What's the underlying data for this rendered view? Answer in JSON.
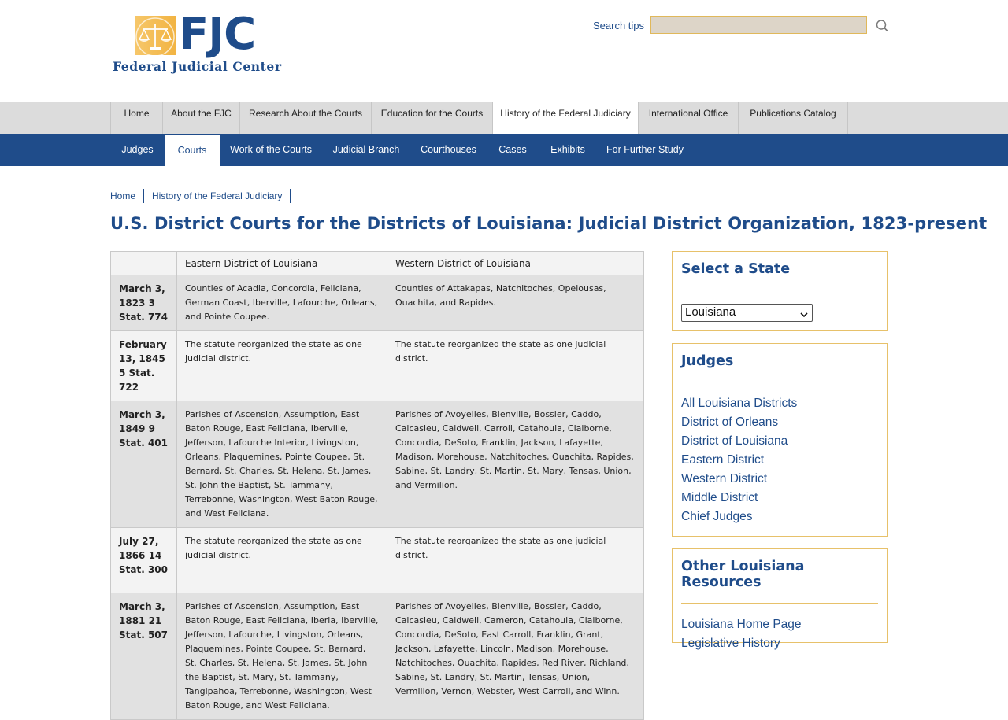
{
  "header": {
    "logo_letters": "FJC",
    "logo_sub": "Federal Judicial Center",
    "search_tips": "Search tips",
    "search_placeholder": ""
  },
  "topnav": [
    {
      "label": "Home"
    },
    {
      "label": "About the FJC"
    },
    {
      "label": "Research About the Courts"
    },
    {
      "label": "Education for the Courts"
    },
    {
      "label": "History of the Federal Judiciary",
      "active": true
    },
    {
      "label": "International Office"
    },
    {
      "label": "Publications Catalog"
    }
  ],
  "subnav": [
    {
      "label": "Judges"
    },
    {
      "label": "Courts",
      "active": true
    },
    {
      "label": "Work of the Courts"
    },
    {
      "label": "Judicial Branch"
    },
    {
      "label": "Courthouses"
    },
    {
      "label": "Cases"
    },
    {
      "label": "Exhibits"
    },
    {
      "label": "For Further Study"
    }
  ],
  "breadcrumb": [
    "Home",
    "History of the Federal Judiciary"
  ],
  "page_title": "U.S. District Courts for the Districts of Louisiana: Judicial District Organization, 1823-present",
  "table": {
    "headers": [
      "",
      "Eastern District of Louisiana",
      "Western District of Louisiana"
    ],
    "rows": [
      {
        "date": "March 3, 1823 3 Stat. 774",
        "eastern": "Counties of Acadia, Concordia, Feliciana, German Coast, Iberville, Lafourche, Orleans, and Pointe Coupee.",
        "western": "Counties of Attakapas, Natchitoches, Opelousas, Ouachita, and Rapides."
      },
      {
        "date": "February 13, 1845 5 Stat. 722",
        "eastern": "The statute reorganized the state as one judicial district.",
        "western": "The statute reorganized the state as one judicial district."
      },
      {
        "date": "March 3, 1849 9 Stat. 401",
        "eastern": "Parishes of Ascension, Assumption, East Baton Rouge, East Feliciana, Iberville, Jefferson, Lafourche Interior, Livingston, Orleans, Plaquemines, Pointe Coupee, St. Bernard, St. Charles, St. Helena, St. James, St. John the Baptist, St. Tammany, Terrebonne, Washington, West Baton Rouge, and West Feliciana.",
        "western": "Parishes of Avoyelles, Bienville, Bossier, Caddo, Calcasieu, Caldwell, Carroll, Catahoula, Claiborne, Concordia, DeSoto, Franklin, Jackson, Lafayette, Madison, Morehouse, Natchitoches, Ouachita, Rapides, Sabine, St. Landry, St. Martin, St. Mary, Tensas, Union, and Vermilion."
      },
      {
        "date": "July 27, 1866 14 Stat. 300",
        "eastern": "The statute reorganized the state as one judicial district.",
        "western": "The statute reorganized the state as one judicial district."
      },
      {
        "date": "March 3, 1881 21 Stat. 507",
        "eastern": "Parishes of Ascension, Assumption, East Baton Rouge, East Feliciana, Iberia, Iberville, Jefferson, Lafourche, Livingston, Orleans, Plaquemines, Pointe Coupee, St. Bernard, St. Charles, St. Helena, St. James, St. John the Baptist, St. Mary, St. Tammany, Tangipahoa, Terrebonne, Washington, West Baton Rouge, and West Feliciana.",
        "western": "Parishes of Avoyelles, Bienville, Bossier, Caddo, Calcasieu, Caldwell, Cameron, Catahoula, Claiborne, Concordia, DeSoto, East Carroll, Franklin, Grant, Jackson, Lafayette, Lincoln, Madison, Morehouse, Natchitoches, Ouachita, Rapides, Red River, Richland, Sabine, St. Landry, St. Martin, Tensas, Union, Vermilion, Vernon, Webster, West Carroll, and Winn."
      }
    ]
  },
  "sidebar": {
    "select_state": {
      "title": "Select a State",
      "selected": "Louisiana"
    },
    "judges": {
      "title": "Judges",
      "links": [
        "All Louisiana Districts",
        "District of Orleans",
        "District of Louisiana",
        "Eastern District",
        "Western District",
        "Middle District",
        "Chief Judges"
      ]
    },
    "resources": {
      "title": "Other Louisiana Resources",
      "links": [
        "Louisiana Home Page",
        "Legislative History"
      ]
    }
  },
  "colors": {
    "brand_blue": "#1f4c8a",
    "gold": "#f2b443",
    "box_border": "#e7c16a"
  },
  "icons": {
    "search": "magnifier-icon",
    "logo": "scales-of-justice-icon"
  }
}
